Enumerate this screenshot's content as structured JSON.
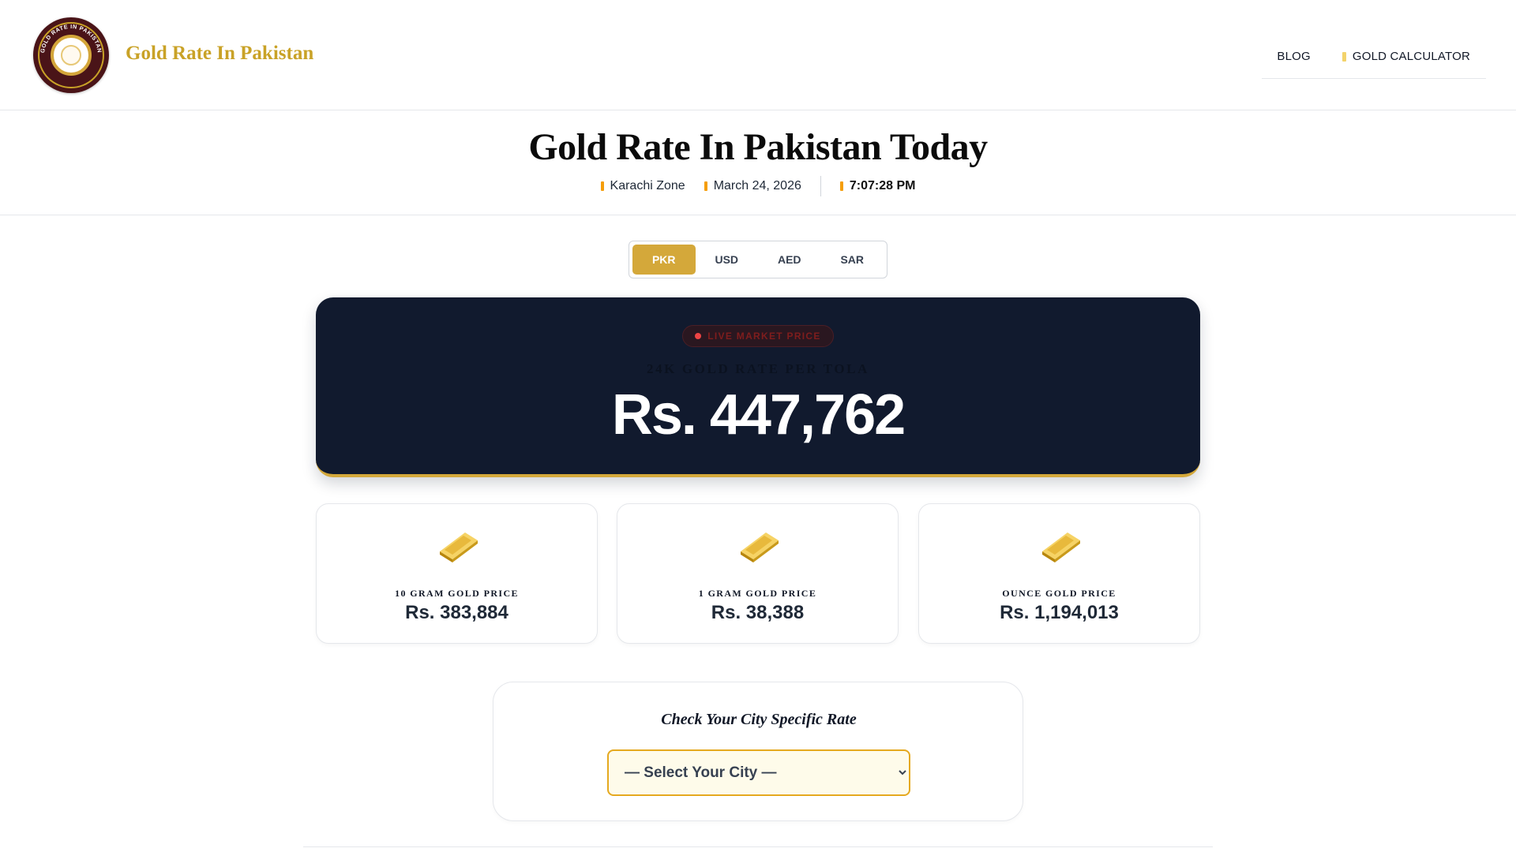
{
  "header": {
    "brand_title": "Gold Rate In Pakistan",
    "logo_text": "GOLD RATE IN PAKISTAN",
    "nav": [
      {
        "label": "BLOG",
        "icon": ""
      },
      {
        "label": "GOLD CALCULATOR",
        "icon": "calculator-icon"
      }
    ]
  },
  "title_area": {
    "title": "Gold Rate In Pakistan Today",
    "zone": "Karachi Zone",
    "date": "March 24, 2026",
    "time": "7:07:28 PM"
  },
  "currency_tabs": [
    {
      "label": "PKR",
      "active": true
    },
    {
      "label": "USD",
      "active": false
    },
    {
      "label": "AED",
      "active": false
    },
    {
      "label": "SAR",
      "active": false
    }
  ],
  "hero": {
    "badge": "LIVE MARKET PRICE",
    "label": "24K GOLD RATE PER TOLA",
    "price": "Rs. 447,762"
  },
  "cards": [
    {
      "label": "10 GRAM GOLD PRICE",
      "value": "Rs. 383,884"
    },
    {
      "label": "1 GRAM GOLD PRICE",
      "value": "Rs. 38,388"
    },
    {
      "label": "OUNCE GOLD PRICE",
      "value": "Rs. 1,194,013"
    }
  ],
  "city": {
    "title": "Check Your City Specific Rate",
    "selected": "— Select Your City —"
  },
  "colors": {
    "accent": "#d4a83a",
    "hero_bg": "#111a2e",
    "brand": "#c9a227"
  }
}
